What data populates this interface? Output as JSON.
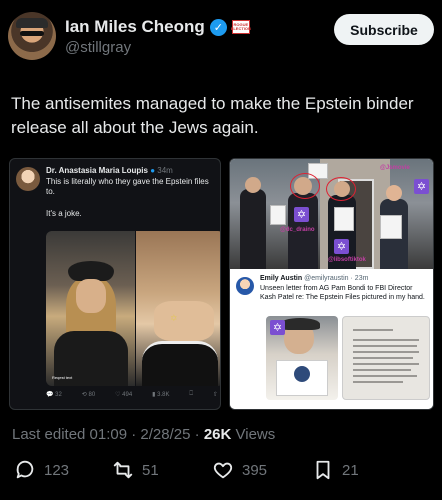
{
  "author": {
    "display_name": "Ian Miles Cheong",
    "handle": "@stillgray",
    "affiliate_badge": "ROGUE\nELECTION"
  },
  "subscribe_label": "Subscribe",
  "tweet_text": "The antisemites managed to make the Epstein binder release all about the Jews again.",
  "quoted_left": {
    "author": "Dr. Anastasia Maria Loupis",
    "time": "34m",
    "text": "This is literally who they gave the Epstein files to.",
    "text2": "It's a joke.",
    "photo_label": "Reqest text",
    "metrics": {
      "replies": "32",
      "reposts": "80",
      "likes": "494",
      "views": "3.8K"
    }
  },
  "quoted_right": {
    "photo_annotations": {
      "top": "@Jsmovie",
      "middle": "@dc_draino",
      "bottom": "@libsoftiktok"
    },
    "author": "Emily Austin",
    "handle": "@emilyraustin",
    "time": "23m",
    "text": "Unseen letter from AG Pam Bondi to FBI Director Kash Patel re: The Epstein Files pictured in my hand."
  },
  "meta": {
    "last_edited": "Last edited 01:09 · 2/28/25 · ",
    "views_count": "26K",
    "views_label": " Views"
  },
  "actions": {
    "replies": "123",
    "reposts": "51",
    "likes": "395",
    "bookmarks": "21"
  },
  "colors": {
    "background": "#000000",
    "verified": "#1d9bf0",
    "muted": "#71767b",
    "text": "#e7e9ea"
  }
}
